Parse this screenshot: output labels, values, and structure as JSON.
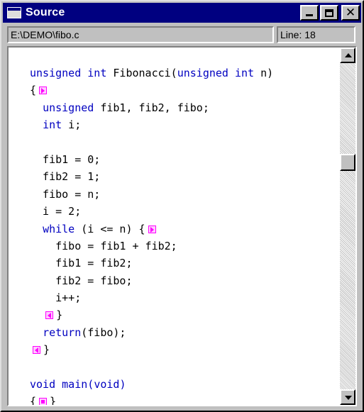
{
  "window": {
    "title": "Source"
  },
  "header": {
    "path": "E:\\DEMO\\fibo.c",
    "line": "Line: 18"
  },
  "code": {
    "lines": [
      [
        {
          "t": "unsigned int",
          "k": true
        },
        {
          "t": " Fibonacci("
        },
        {
          "t": "unsigned int",
          "k": true
        },
        {
          "t": " n)"
        }
      ],
      [
        {
          "t": "{"
        },
        {
          "fold": "exp"
        }
      ],
      [
        {
          "t": "  "
        },
        {
          "t": "unsigned",
          "k": true
        },
        {
          "t": " fib1, fib2, fibo;"
        }
      ],
      [
        {
          "t": "  "
        },
        {
          "t": "int",
          "k": true
        },
        {
          "t": " i;"
        }
      ],
      [],
      [
        {
          "t": "  fib1 = 0;"
        }
      ],
      [
        {
          "t": "  fib2 = 1;"
        }
      ],
      [
        {
          "t": "  fibo = n;"
        }
      ],
      [
        {
          "t": "  i = 2;"
        }
      ],
      [
        {
          "t": "  "
        },
        {
          "t": "while",
          "k": true
        },
        {
          "t": " (i <= n) {"
        },
        {
          "fold": "exp"
        }
      ],
      [
        {
          "t": "    fibo = fib1 + fib2;"
        }
      ],
      [
        {
          "t": "    fib1 = fib2;"
        }
      ],
      [
        {
          "t": "    fib2 = fibo;"
        }
      ],
      [
        {
          "t": "    i++;"
        }
      ],
      [
        {
          "t": "  "
        },
        {
          "fold": "col"
        },
        {
          "t": "}"
        }
      ],
      [
        {
          "t": "  "
        },
        {
          "t": "return",
          "k": true
        },
        {
          "t": "(fibo);"
        }
      ],
      [
        {
          "fold": "col"
        },
        {
          "t": "}"
        }
      ],
      [],
      [
        {
          "t": "void main(",
          "k": true
        },
        {
          "t": "void",
          "k": true
        },
        {
          "t": ")",
          "k": true
        }
      ],
      [
        {
          "t": "{"
        },
        {
          "fold": "box"
        },
        {
          "t": "}"
        }
      ]
    ]
  },
  "icons": {
    "system": "window-icon",
    "minimize": "minimize-icon",
    "maximize": "maximize-icon",
    "close": "close-icon",
    "fold_expanded": "fold-expand-icon",
    "fold_collapse": "fold-collapse-icon",
    "fold_collapsed": "fold-collapsed-icon",
    "scroll_up": "scroll-up-icon",
    "scroll_down": "scroll-down-icon"
  },
  "colors": {
    "titlebar": "#000080",
    "keyword": "#0000c0",
    "fold_marker": "#ff00ff",
    "background": "#c0c0c0"
  }
}
